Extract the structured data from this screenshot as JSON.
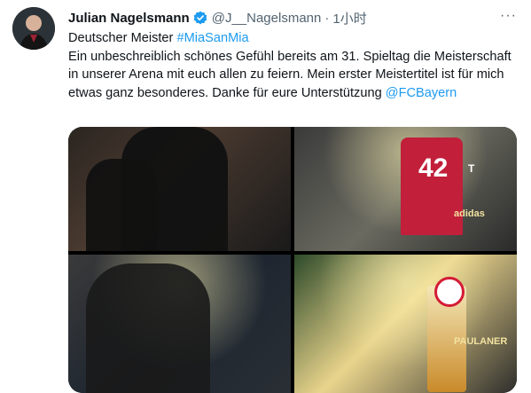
{
  "tweet": {
    "display_name": "Julian Nagelsmann",
    "handle": "@J__Nagelsmann",
    "separator": "·",
    "time": "1小时",
    "more": "···",
    "text": {
      "line1_prefix": "Deutscher Meister ",
      "hashtag": "#MiaSanMia",
      "body": "Ein unbeschreiblich schönes Gefühl bereits am 31. Spieltag die Meisterschaft in unserer Arena mit euch allen zu feiern. Mein erster Meistertitel ist für mich etwas ganz besonderes. Danke für eure Unterstützung ",
      "mention": "@FCBayern"
    }
  },
  "media": {
    "photo2_jersey_number": "42",
    "photo2_brand": "T",
    "photo2_sponsor": "adidas",
    "photo4_label": "PAULANER"
  },
  "colors": {
    "link": "#1d9bf0",
    "verified": "#1d9bf0",
    "jersey": "#c21f3a"
  }
}
